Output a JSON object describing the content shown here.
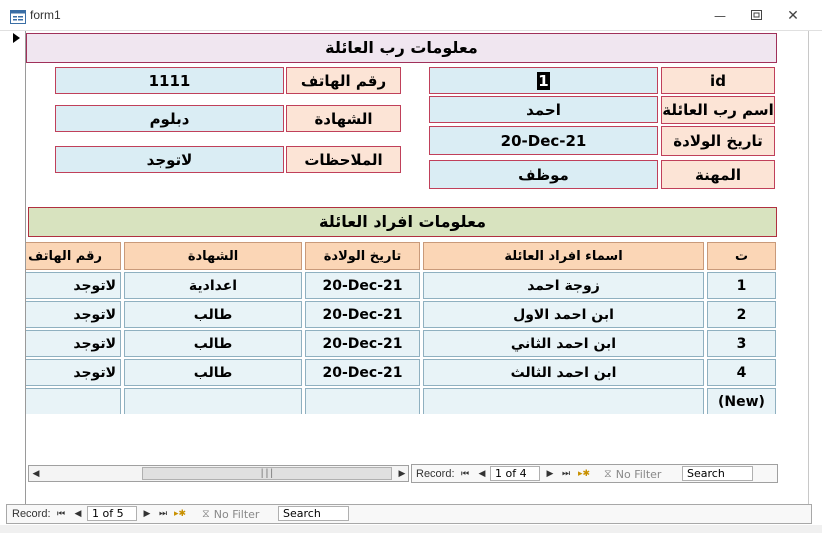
{
  "window": {
    "title": "form1"
  },
  "header": {
    "title": "معلومات رب العائلة"
  },
  "fields": {
    "id_label": "id",
    "id_value": "1",
    "head_name_label": "اسم رب العائلة",
    "head_name_value": "احمد",
    "birth_label": "تاريخ الولادة",
    "birth_value": "20-Dec-21",
    "job_label": "المهنة",
    "job_value": "موظف",
    "phone_label": "رقم الهاتف",
    "phone_value": "1111",
    "cert_label": "الشهادة",
    "cert_value": "دبلوم",
    "notes_label": "الملاحظات",
    "notes_value": "لاتوجد"
  },
  "family": {
    "title": "معلومات افراد العائلة",
    "columns": [
      "ت",
      "اسماء افراد العائلة",
      "تاريخ الولادة",
      "الشهادة",
      "رقم الهاتف"
    ],
    "rows": [
      [
        "1",
        "زوجة احمد",
        "20-Dec-21",
        "اعدادية",
        "لاتوجد"
      ],
      [
        "2",
        "ابن احمد الاول",
        "20-Dec-21",
        "طالب",
        "لاتوجد"
      ],
      [
        "3",
        "ابن احمد الثاني",
        "20-Dec-21",
        "طالب",
        "لاتوجد"
      ],
      [
        "4",
        "ابن احمد الثالث",
        "20-Dec-21",
        "طالب",
        "لاتوجد"
      ]
    ],
    "new_row_label": "(New)"
  },
  "subnav": {
    "record_label": "Record:",
    "position": "1 of 4",
    "filter": "No Filter",
    "search": "Search"
  },
  "mainnav": {
    "record_label": "Record:",
    "position": "1 of 5",
    "filter": "No Filter",
    "search": "Search"
  },
  "icons": {
    "window": "form-icon",
    "minimize": "minimize-icon",
    "maximize": "maximize-icon",
    "close": "close-icon"
  }
}
